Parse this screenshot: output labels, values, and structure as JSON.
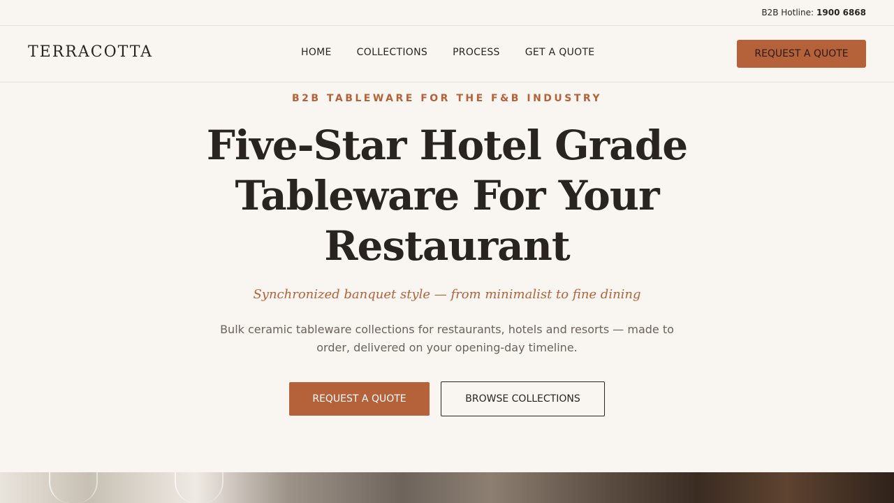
{
  "topbar": {
    "hotline_label": "B2B Hotline:",
    "hotline_number": "1900 6868"
  },
  "brand": {
    "name": "TERRACOTTA"
  },
  "nav": {
    "items": [
      {
        "label": "HOME"
      },
      {
        "label": "COLLECTIONS"
      },
      {
        "label": "PROCESS"
      },
      {
        "label": "GET A QUOTE"
      }
    ],
    "cta_label": "REQUEST A QUOTE"
  },
  "hero": {
    "eyebrow": "B2B TABLEWARE FOR THE F&B INDUSTRY",
    "headline": "Five-Star Hotel Grade Tableware For Your Restaurant",
    "tagline": "Synchronized banquet style — from minimalist to fine dining",
    "description": "Bulk ceramic tableware collections for restaurants, hotels and resorts — made to order, delivered on your opening-day timeline.",
    "primary_button": "REQUEST A QUOTE",
    "secondary_button": "BROWSE COLLECTIONS"
  },
  "colors": {
    "accent": "#b5613a",
    "background": "#f9f6f1",
    "text": "#2a2420",
    "muted_text": "#6b625a"
  }
}
